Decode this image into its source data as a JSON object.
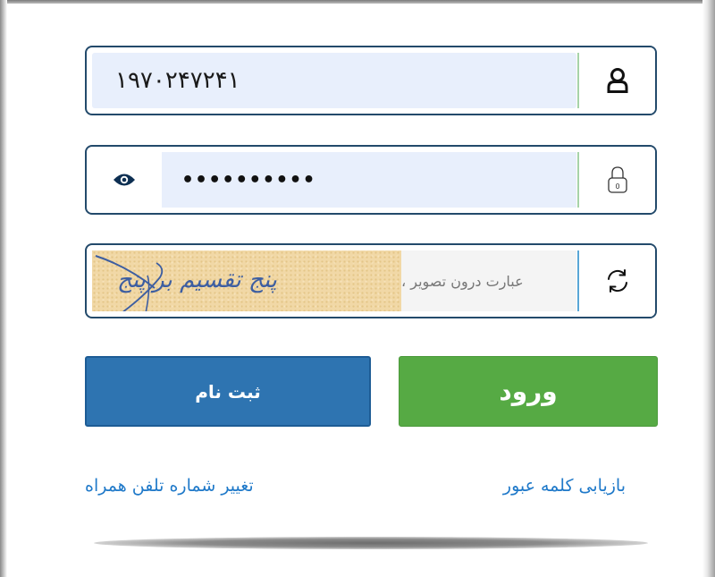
{
  "login_form": {
    "username": {
      "value": "۱۹۷۰۲۴۷۲۴۱",
      "icon": "user-icon"
    },
    "password": {
      "value": "••••••••••",
      "toggle_icon": "eye-icon",
      "icon": "lock-icon",
      "lock_badge": "0"
    },
    "captcha": {
      "placeholder": "عبارت درون تصویر ،",
      "image_text": "پنج تقسیم بر پنج",
      "refresh_icon": "refresh-icon"
    },
    "buttons": {
      "login_label": "ورود",
      "register_label": "ثبت نام"
    },
    "links": {
      "recover_password": "بازیابی کلمه عبور",
      "change_phone": "تغییر شماره تلفن همراه"
    }
  },
  "colors": {
    "border": "#234a6b",
    "input_bg": "#e8effc",
    "login_green": "#56aa44",
    "register_blue": "#2e74b1",
    "link_blue": "#1f79c9",
    "captcha_bg": "#f1d8a6"
  }
}
